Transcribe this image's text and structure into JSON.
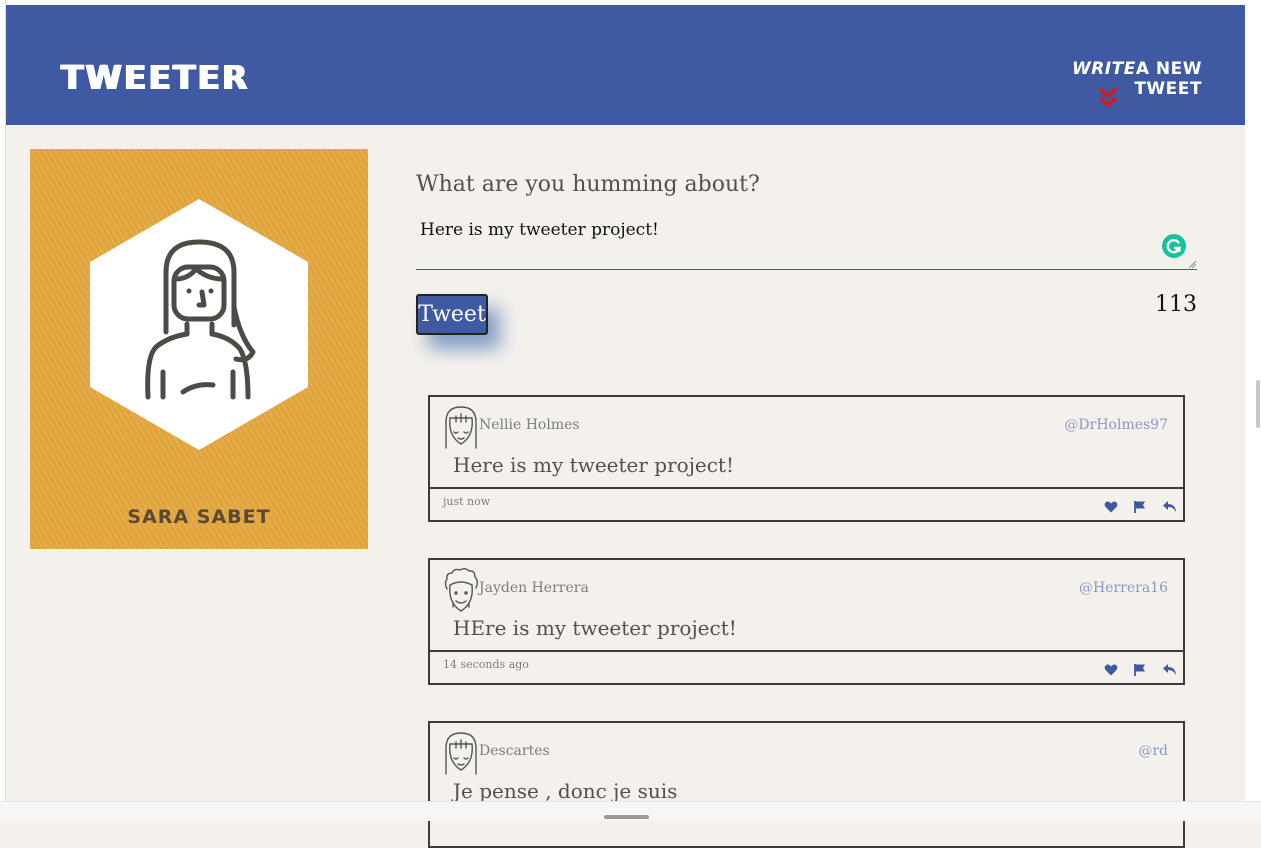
{
  "nav": {
    "brand": "TWEETER",
    "compose_write": "WRITE",
    "compose_rest": "A NEW TWEET",
    "chevron_icon": "double-chevron-down-icon",
    "chevron_color": "#c8202a",
    "background": "#3f5aa3"
  },
  "profile": {
    "name": "SARA SABET",
    "background": "#e6a940"
  },
  "composer": {
    "label": "What are you humming about?",
    "value": "Here is my tweeter project!",
    "button_label": "Tweet",
    "counter": "113"
  },
  "tweets": [
    {
      "name": "Nellie Holmes",
      "handle": "@DrHolmes97",
      "text": "Here is my tweeter project!",
      "time": "just now"
    },
    {
      "name": "Jayden Herrera",
      "handle": "@Herrera16",
      "text": "HEre is my tweeter project!",
      "time": "14 seconds ago"
    },
    {
      "name": "Descartes",
      "handle": "@rd",
      "text": "Je pense , donc je suis",
      "time": ""
    }
  ],
  "tweet_actions": [
    "heart-icon",
    "flag-icon",
    "retweet-icon"
  ],
  "accent": "#3f5aa3"
}
